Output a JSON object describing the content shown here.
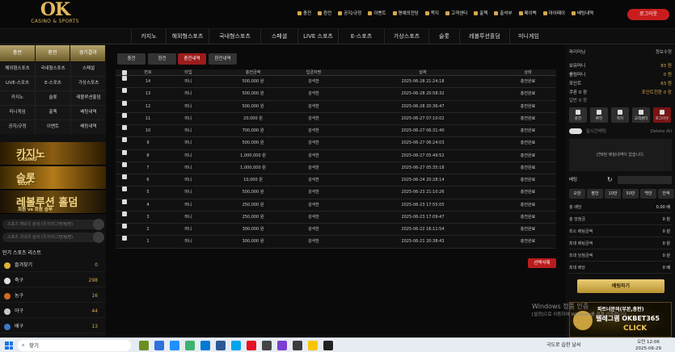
{
  "logo": {
    "text": "OK",
    "subtitle": "CASINO & SPORTS"
  },
  "topmenu": [
    "충전",
    "환전",
    "공지/규정",
    "이벤트",
    "명예의전당",
    "쪽지",
    "고객센터",
    "출첵",
    "출석부",
    "페이백",
    "마이페이",
    "배팅내역"
  ],
  "logout_label": "로그아웃",
  "gamenav": [
    "카지노",
    "해외형스포츠",
    "국내형스포츠",
    "스페셜",
    "LIVE 스포츠",
    "E-스포츠",
    "가상스포츠",
    "슬롯",
    "레볼루션홀덤",
    "미니게임"
  ],
  "left": {
    "top_buttons": [
      "충전",
      "환전",
      "경기결과"
    ],
    "grid1": [
      "해외형스포츠",
      "국내형스포츠",
      "스페셜",
      "LIVE-스포츠",
      "E-스포츠",
      "가상스포츠",
      "카지노",
      "슬롯",
      "레볼루션홀덤",
      "미니게임",
      "출첵",
      "배팅내역",
      "공지/규정",
      "이벤트",
      "배팅내역"
    ],
    "banners": [
      {
        "title": "카지노",
        "sub": "CASINO"
      },
      {
        "title": "슬롯",
        "sub": "SLOT"
      },
      {
        "title": "레볼루션 홀덤",
        "sub": "회원 vs 회원 승부"
      }
    ],
    "search1": "스포츠 해외국 검색 (국가/리그명/팀명)",
    "search2": "스포츠 국내국 검색 (국가/리그명/팀명)",
    "popular_title": "인기 스포츠 리스트",
    "sports": [
      {
        "name": "즐겨찾기",
        "count": "0"
      },
      {
        "name": "축구",
        "count": "298"
      },
      {
        "name": "농구",
        "count": "16"
      },
      {
        "name": "야구",
        "count": "44"
      },
      {
        "name": "배구",
        "count": "13"
      }
    ]
  },
  "tabs": [
    "충전",
    "환전",
    "충전내역",
    "환전내역"
  ],
  "active_tab": 2,
  "table": {
    "headers": [
      "번호",
      "타입",
      "충전금액",
      "입금자명",
      "날짜",
      "상태"
    ],
    "rows": [
      [
        "14",
        "머니",
        "500,000 원",
        "강석찬",
        "2025-06-28 21:24:18",
        "충전완료"
      ],
      [
        "13",
        "머니",
        "500,000 원",
        "강석찬",
        "2025-06-28 20:58:32",
        "충전완료"
      ],
      [
        "12",
        "머니",
        "500,000 원",
        "강석찬",
        "2025-06-28 20:36:47",
        "충전완료"
      ],
      [
        "11",
        "머니",
        "20,000 원",
        "강석찬",
        "2025-06-27 07:10:02",
        "충전완료"
      ],
      [
        "10",
        "머니",
        "700,000 원",
        "강석찬",
        "2025-06-27 06:31:40",
        "충전완료"
      ],
      [
        "9",
        "머니",
        "500,000 원",
        "강석찬",
        "2025-06-27 06:24:03",
        "충전완료"
      ],
      [
        "8",
        "머니",
        "1,000,000 원",
        "강석찬",
        "2025-06-27 05:49:52",
        "충전완료"
      ],
      [
        "7",
        "머니",
        "1,000,000 원",
        "강석찬",
        "2025-06-27 05:35:18",
        "충전완료"
      ],
      [
        "6",
        "머니",
        "10,000 원",
        "강석찬",
        "2025-06-24 20:28:14",
        "충전완료"
      ],
      [
        "5",
        "머니",
        "500,000 원",
        "강석찬",
        "2025-06-23 21:10:26",
        "충전완료"
      ],
      [
        "4",
        "머니",
        "250,000 원",
        "강석찬",
        "2025-06-23 17:55:05",
        "충전완료"
      ],
      [
        "3",
        "머니",
        "250,000 원",
        "강석찬",
        "2025-06-23 17:09:47",
        "충전완료"
      ],
      [
        "2",
        "머니",
        "300,000 원",
        "강석찬",
        "2025-06-22 16:11:54",
        "충전완료"
      ],
      [
        "1",
        "머니",
        "300,000 원",
        "강석찬",
        "2025-06-21 20:38:43",
        "충전완료"
      ]
    ]
  },
  "delete_label": "선택삭제",
  "right": {
    "header_left": "파리머님",
    "header_right": "정보수정",
    "rows": [
      {
        "label": "보유머니",
        "value": "83 원"
      },
      {
        "label": "롤링머니",
        "value": "0 원"
      },
      {
        "label": "포인트",
        "value": "63 원"
      }
    ],
    "coupon_left": "쿠폰 0 장",
    "coupon_right": "포인트전환 0 장",
    "rolling_left": "일반 0 장",
    "quick": [
      "충전",
      "환전",
      "쪽지",
      "고객센터",
      "로그아웃"
    ],
    "live_toggle": "실시간배팅",
    "delete_all": "Delete All",
    "empty_msg": "선택된 배팅내역이 없습니다.",
    "bet_label": "배팅",
    "chips": [
      "오만",
      "팔만",
      "10만",
      "50만",
      "백만",
      "잔액"
    ],
    "bet_rows": [
      {
        "label": "총 배당",
        "value": "0.00 배"
      },
      {
        "label": "총 당첨금",
        "value": "0 원"
      },
      {
        "label": "최소 배팅금액",
        "value": "0 원"
      },
      {
        "label": "최대 배팅금액",
        "value": "0 원"
      },
      {
        "label": "최대 당첨금액",
        "value": "0 원"
      },
      {
        "label": "최대 배당",
        "value": "0 배"
      }
    ],
    "bet_button": "배팅하기",
    "ad": {
      "line1": "파트너문의(부본,총판)",
      "line2": "텔레그램 OKBET365",
      "line3": "CLICK"
    }
  },
  "watermark": {
    "line1": "Windows 정품 인증",
    "line2": "[설정]으로 이동하여 Windows를 정품 인증합니다."
  },
  "taskbar": {
    "search": "찾기",
    "tray_text": "극도로 습한 날씨",
    "time": "오전 12:06",
    "date": "2025-06-29"
  }
}
